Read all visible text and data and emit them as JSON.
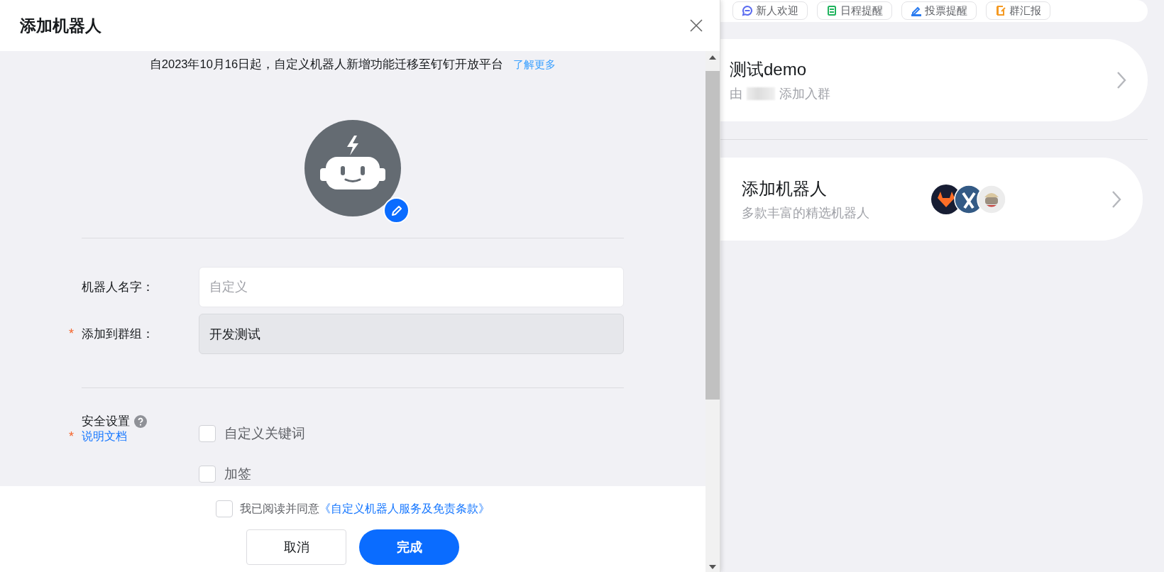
{
  "dialog": {
    "title": "添加机器人",
    "notice": {
      "text": "自2023年10月16日起，自定义机器人新增功能迁移至钉钉开放平台",
      "link": "了解更多"
    },
    "fields": [
      {
        "label": "机器人名字：",
        "placeholder": "自定义",
        "disabled": false
      },
      {
        "label": "添加到群组：",
        "required_mark": "*",
        "value": "开发测试",
        "disabled": true
      }
    ],
    "security": {
      "label": "安全设置",
      "required_mark": "*",
      "help_link": "说明文档",
      "options": [
        {
          "label": "自定义关键词",
          "checked": false
        },
        {
          "label": "加签",
          "checked": false
        }
      ]
    },
    "agreement": {
      "checked": false,
      "text": "我已阅读并同意",
      "link": "《自定义机器人服务及免责条款》"
    },
    "buttons": [
      {
        "label": "取消",
        "kind": "secondary"
      },
      {
        "label": "完成",
        "kind": "primary"
      }
    ]
  },
  "side": {
    "quick_actions": [
      {
        "label": "新人欢迎",
        "kind": "chat",
        "color": "#5b6cf0"
      },
      {
        "label": "日程提醒",
        "kind": "list",
        "color": "#1fb35d"
      },
      {
        "label": "投票提醒",
        "kind": "vote",
        "color": "#2b7cf0"
      },
      {
        "label": "群汇报",
        "kind": "report",
        "color": "#f59a23"
      }
    ],
    "group_card": {
      "title": "测试demo",
      "prefix": "由",
      "suffix": "添加入群"
    },
    "robot_card": {
      "title": "添加机器人",
      "subtitle": "多款丰富的精选机器人"
    }
  }
}
